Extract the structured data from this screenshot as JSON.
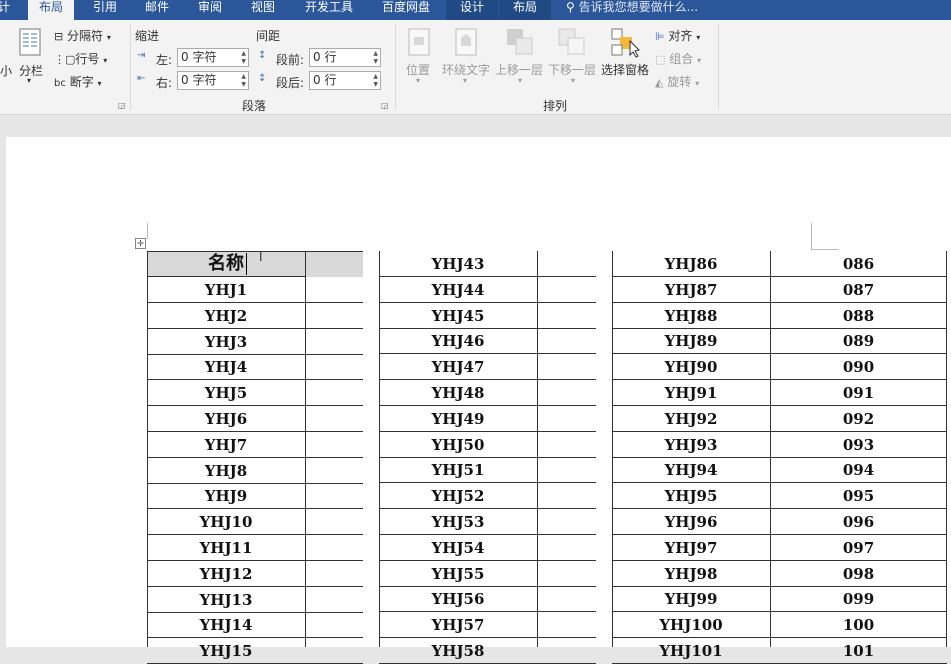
{
  "tabs": [
    {
      "label": "计",
      "active": false
    },
    {
      "label": "布局",
      "active": true
    },
    {
      "label": "引用",
      "active": false
    },
    {
      "label": "邮件",
      "active": false
    },
    {
      "label": "审阅",
      "active": false
    },
    {
      "label": "视图",
      "active": false
    },
    {
      "label": "开发工具",
      "active": false
    },
    {
      "label": "百度网盘",
      "active": false
    },
    {
      "label": "设计",
      "active": false
    },
    {
      "label": "布局",
      "active": false
    }
  ],
  "tell_me": "告诉我您想要做什么...",
  "ribbon": {
    "left_cut": "小",
    "columns": "分栏",
    "breaks": "分隔符",
    "line_numbers": "行号",
    "hyphenation": "断字",
    "indent_title": "缩进",
    "spacing_title": "间距",
    "indent_left_label": "左:",
    "indent_left_value": "0 字符",
    "indent_right_label": "右:",
    "indent_right_value": "0 字符",
    "space_before_label": "段前:",
    "space_before_value": "0 行",
    "space_after_label": "段后:",
    "space_after_value": "0 行",
    "paragraph_group": "段落",
    "position": "位置",
    "wrap_text": "环绕文字",
    "bring_forward": "上移一层",
    "send_backward": "下移一层",
    "selection_pane": "选择窗格",
    "align": "对齐",
    "group": "组合",
    "rotate": "旋转",
    "arrange_group": "排列"
  },
  "table": {
    "header": "名称",
    "col1": [
      "YHJ1",
      "YHJ2",
      "YHJ3",
      "YHJ4",
      "YHJ5",
      "YHJ6",
      "YHJ7",
      "YHJ8",
      "YHJ9",
      "YHJ10",
      "YHJ11",
      "YHJ12",
      "YHJ13",
      "YHJ14",
      "YHJ15"
    ],
    "col2": [
      "YHJ43",
      "YHJ44",
      "YHJ45",
      "YHJ46",
      "YHJ47",
      "YHJ48",
      "YHJ49",
      "YHJ50",
      "YHJ51",
      "YHJ52",
      "YHJ53",
      "YHJ54",
      "YHJ55",
      "YHJ56",
      "YHJ57",
      "YHJ58"
    ],
    "col3_names": [
      "YHJ86",
      "YHJ87",
      "YHJ88",
      "YHJ89",
      "YHJ90",
      "YHJ91",
      "YHJ92",
      "YHJ93",
      "YHJ94",
      "YHJ95",
      "YHJ96",
      "YHJ97",
      "YHJ98",
      "YHJ99",
      "YHJ100",
      "YHJ101"
    ],
    "col3_codes": [
      "086",
      "087",
      "088",
      "089",
      "090",
      "091",
      "092",
      "093",
      "094",
      "095",
      "096",
      "097",
      "098",
      "099",
      "100",
      "101"
    ]
  }
}
